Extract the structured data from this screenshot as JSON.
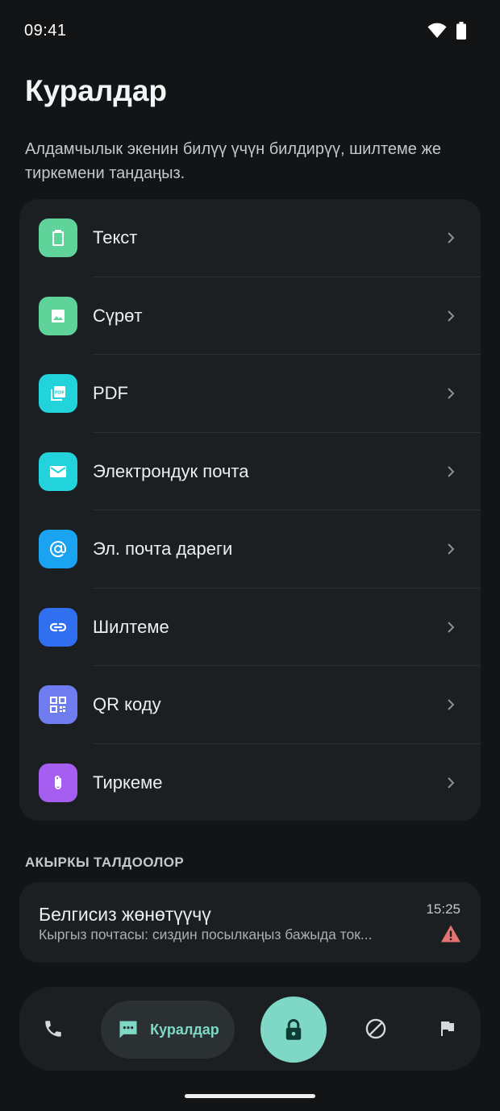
{
  "status_bar": {
    "time": "09:41"
  },
  "page": {
    "title": "Куралдар",
    "subtitle": "Алдамчылык экенин билүү үчүн билдирүү, шилтеме же тиркемени тандаңыз."
  },
  "tools": [
    {
      "label": "Текст",
      "icon": "clipboard-icon",
      "color": "#5fd39a"
    },
    {
      "label": "Сүрөт",
      "icon": "image-icon",
      "color": "#5fd39a"
    },
    {
      "label": "PDF",
      "icon": "pdf-icon",
      "color": "#22d3dc"
    },
    {
      "label": "Электрондук почта",
      "icon": "mail-icon",
      "color": "#22d3dc"
    },
    {
      "label": "Эл. почта дареги",
      "icon": "at-sign-icon",
      "color": "#1aa3f0"
    },
    {
      "label": "Шилтеме",
      "icon": "link-icon",
      "color": "#2f6ff0"
    },
    {
      "label": "QR коду",
      "icon": "qr-code-icon",
      "color": "#6e7cf0"
    },
    {
      "label": "Тиркеме",
      "icon": "paperclip-icon",
      "color": "#a55ef0"
    }
  ],
  "recent": {
    "header": "АКЫРКЫ ТАЛДООЛОР",
    "items": [
      {
        "title": "Белгисиз жөнөтүүчү",
        "preview": "Кыргыз почтасы: сиздин посылкаңыз бажыда ток...",
        "time": "15:25",
        "status_icon": "warning-icon",
        "status_color": "#e57373"
      }
    ]
  },
  "bottom_nav": {
    "items": [
      {
        "icon": "phone-icon"
      },
      {
        "icon": "chat-icon",
        "label": "Куралдар",
        "active": true
      },
      {
        "icon": "lock-icon",
        "primary": true
      },
      {
        "icon": "block-icon"
      },
      {
        "icon": "flag-icon"
      }
    ]
  },
  "colors": {
    "background": "#121416",
    "card": "#1c1f21",
    "accent": "#7fd8c6"
  }
}
